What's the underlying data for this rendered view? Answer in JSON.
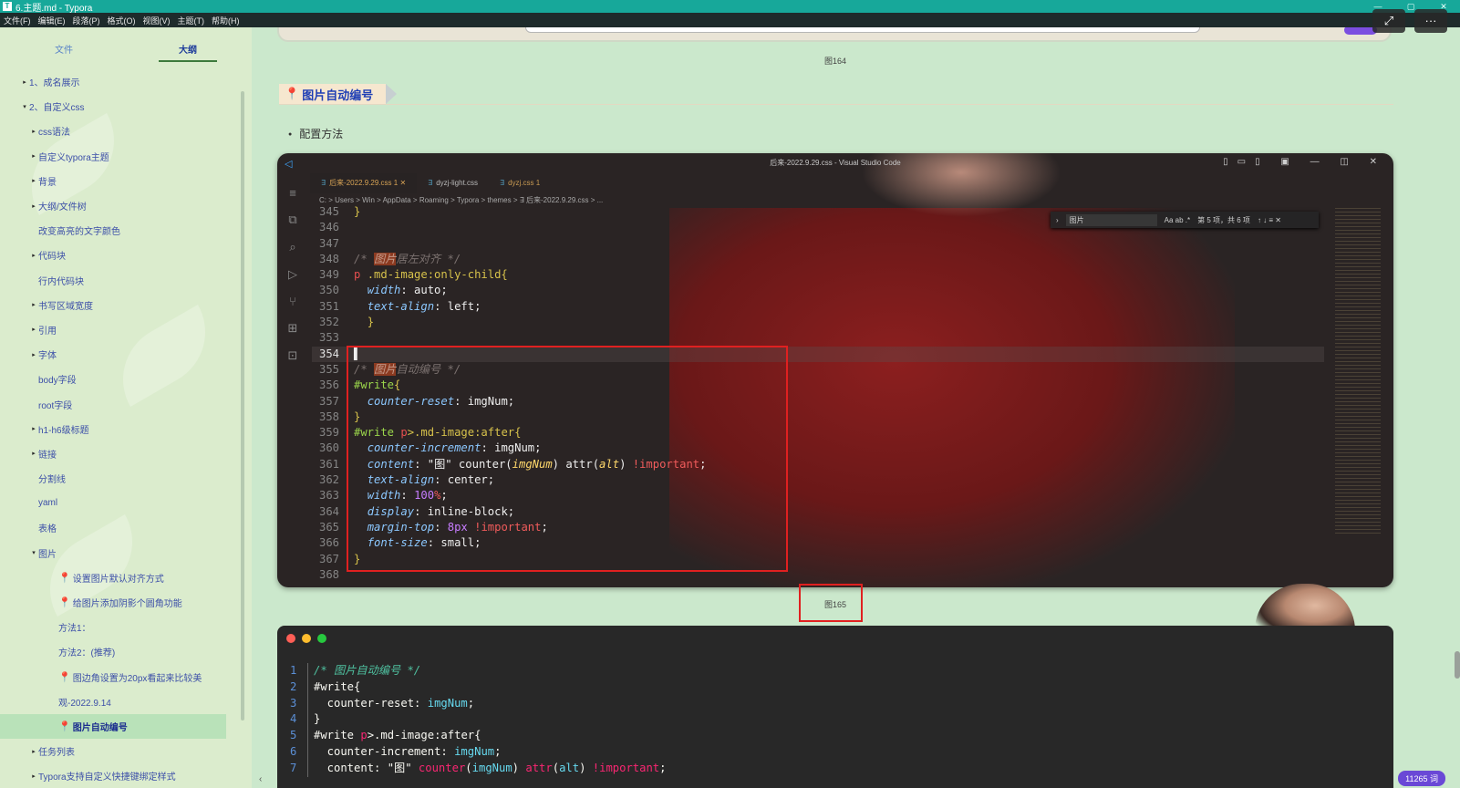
{
  "window": {
    "title": "6.主题.md - Typora",
    "controls": [
      "—",
      "▢",
      "✕"
    ]
  },
  "menu": [
    "文件(F)",
    "编辑(E)",
    "段落(P)",
    "格式(O)",
    "视图(V)",
    "主题(T)",
    "帮助(H)"
  ],
  "sidebar": {
    "tabs": [
      {
        "label": "文件",
        "active": false
      },
      {
        "label": "大纲",
        "active": true
      }
    ],
    "outline": [
      {
        "label": "1、成名展示",
        "indent": 1,
        "tri": "▸"
      },
      {
        "label": "2、自定义css",
        "indent": 1,
        "tri": "▾"
      },
      {
        "label": "css语法",
        "indent": 2,
        "tri": "▸"
      },
      {
        "label": "自定义typora主题",
        "indent": 2,
        "tri": "▸"
      },
      {
        "label": "背景",
        "indent": 2,
        "tri": "▸"
      },
      {
        "label": "大纲/文件树",
        "indent": 2,
        "tri": "▸"
      },
      {
        "label": "改变高亮的文字颜色",
        "indent": 2,
        "tri": ""
      },
      {
        "label": "代码块",
        "indent": 2,
        "tri": "▸"
      },
      {
        "label": "行内代码块",
        "indent": 2,
        "tri": ""
      },
      {
        "label": "书写区域宽度",
        "indent": 2,
        "tri": "▸"
      },
      {
        "label": "引用",
        "indent": 2,
        "tri": "▸"
      },
      {
        "label": "字体",
        "indent": 2,
        "tri": "▸"
      },
      {
        "label": "body字段",
        "indent": 2,
        "tri": ""
      },
      {
        "label": "root字段",
        "indent": 2,
        "tri": ""
      },
      {
        "label": "h1-h6级标题",
        "indent": 2,
        "tri": "▸"
      },
      {
        "label": "链接",
        "indent": 2,
        "tri": "▸"
      },
      {
        "label": "分割线",
        "indent": 2,
        "tri": ""
      },
      {
        "label": "yaml",
        "indent": 2,
        "tri": ""
      },
      {
        "label": "表格",
        "indent": 2,
        "tri": ""
      },
      {
        "label": "图片",
        "indent": 2,
        "tri": "▾"
      },
      {
        "label": "设置图片默认对齐方式",
        "indent": 3,
        "tri": "",
        "pin": true
      },
      {
        "label": "给图片添加阴影个圆角功能",
        "indent": 3,
        "tri": "",
        "pin": true
      },
      {
        "label": "方法1：",
        "indent": 3,
        "tri": ""
      },
      {
        "label": "方法2：(推荐)",
        "indent": 3,
        "tri": ""
      },
      {
        "label": "图边角设置为20px看起来比较美",
        "indent": 3,
        "tri": "",
        "pin": true
      },
      {
        "label": "观-2022.9.14",
        "indent": 3,
        "tri": ""
      },
      {
        "label": "图片自动编号",
        "indent": 3,
        "tri": "",
        "pin": true,
        "active": true
      },
      {
        "label": "任务列表",
        "indent": 2,
        "tri": "▸"
      },
      {
        "label": "Typora支持自定义快捷键绑定样式",
        "indent": 2,
        "tri": "▸"
      }
    ]
  },
  "doc": {
    "caption_top": "图164",
    "heading": "图片自动编号",
    "bullet": "配置方法",
    "caption_mid": "图165",
    "word_count": "11265 词"
  },
  "vscode": {
    "title": "后来-2022.9.29.css - Visual Studio Code",
    "tabs": [
      {
        "label": "后来-2022.9.29.css 1",
        "active": true
      },
      {
        "label": "dyzj-light.css",
        "active": false
      },
      {
        "label": "dyzj.css 1",
        "active": false
      }
    ],
    "breadcrumb": "C: > Users > Win > AppData > Roaming > Typora > themes > ∃ 后来-2022.9.29.css > ...",
    "find_text": "图片",
    "find_opts": "Aa ab .*",
    "find_result": "第 5 项，共 6 项",
    "find_nav": "↑ ↓ ≡ ✕"
  },
  "codeblock": {
    "dot_colors": [
      "#ff5f56",
      "#ffbd2e",
      "#27c93f"
    ]
  },
  "colors": {
    "accent": "#17a89a",
    "sidebar_bg": "#dbeccd",
    "content_bg": "#cbe8cc",
    "highlight_box": "#e02020"
  }
}
